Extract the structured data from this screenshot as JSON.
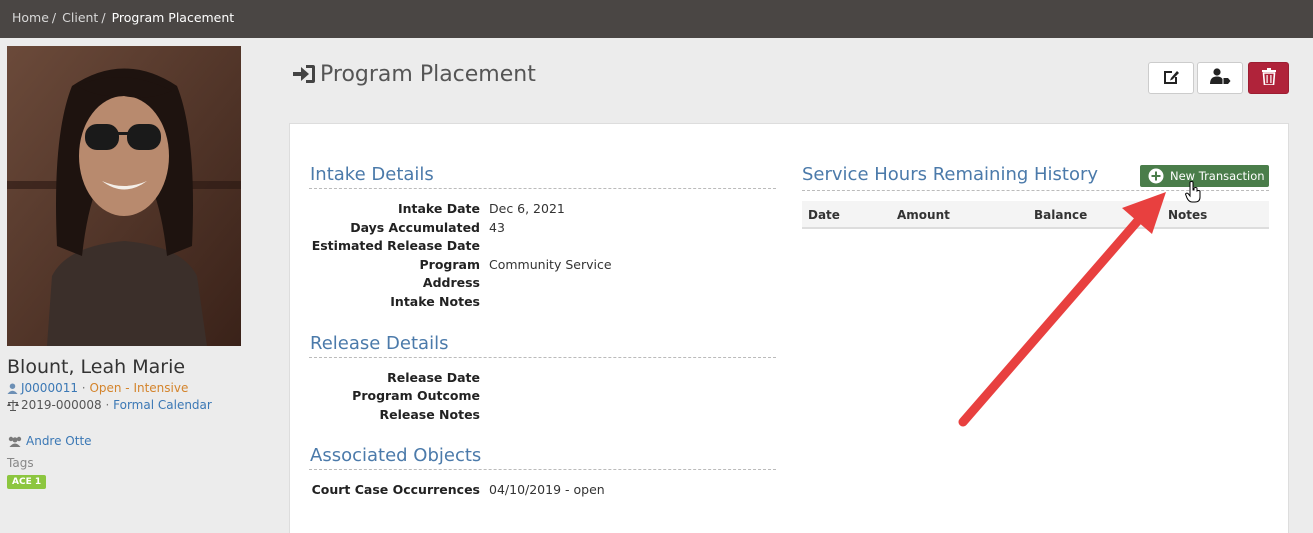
{
  "breadcrumb": {
    "items": [
      "Home",
      "Client",
      "Program Placement"
    ]
  },
  "client": {
    "name": "Blount, Leah Marie",
    "id": "J0000011",
    "status": "Open - Intensive",
    "case_number": "2019-000008",
    "calendar": "Formal Calendar",
    "officer": "Andre Otte",
    "tags_label": "Tags",
    "tags": [
      "ACE 1"
    ]
  },
  "page": {
    "title": "Program Placement"
  },
  "toolbar": {
    "edit_icon": "edit-icon",
    "user_icon": "user-tag-icon",
    "delete_icon": "trash-icon"
  },
  "intake": {
    "title": "Intake Details",
    "rows": [
      {
        "label": "Intake Date",
        "value": "Dec 6, 2021"
      },
      {
        "label": "Days Accumulated",
        "value": "43"
      },
      {
        "label": "Estimated Release Date",
        "value": ""
      },
      {
        "label": "Program",
        "value": "Community Service"
      },
      {
        "label": "Address",
        "value": ""
      },
      {
        "label": "Intake Notes",
        "value": ""
      }
    ]
  },
  "release": {
    "title": "Release Details",
    "rows": [
      {
        "label": "Release Date",
        "value": ""
      },
      {
        "label": "Program Outcome",
        "value": ""
      },
      {
        "label": "Release Notes",
        "value": ""
      }
    ]
  },
  "associated": {
    "title": "Associated Objects",
    "rows": [
      {
        "label": "Court Case Occurrences",
        "value": "04/10/2019 - open"
      }
    ]
  },
  "service_hours": {
    "title": "Service Hours Remaining History",
    "new_button": "New Transaction",
    "columns": [
      "Date",
      "Amount",
      "Balance",
      "Notes"
    ]
  },
  "colors": {
    "topbar": "#4a4644",
    "accent": "#4b7aaa",
    "button_green": "#4a7d4a",
    "danger": "#b0233a",
    "tag": "#8cc63f",
    "arrow": "#e8403f"
  }
}
